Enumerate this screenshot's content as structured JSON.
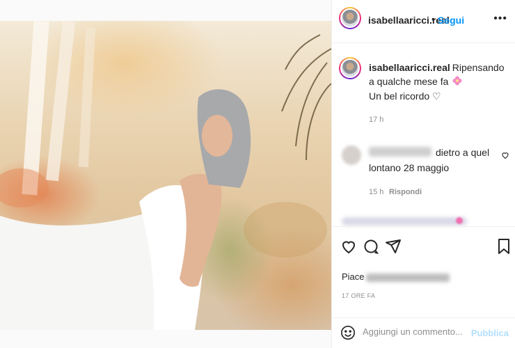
{
  "post": {
    "username": "isabellaaricci.real",
    "follow_label": "Segui",
    "more_label": "•••",
    "caption": "Ripensando a qualche mese fa",
    "caption_line2": "Un bel ricordo ♡",
    "caption_time": "17 h"
  },
  "comment": {
    "text": "dietro a quel lontano 28 maggio",
    "time": "15 h",
    "reply_label": "Rispondi"
  },
  "likes": {
    "prefix": "Piace"
  },
  "posted_ago": "17 ORE FA",
  "add_comment": {
    "placeholder": "Aggiungi un commento...",
    "publish_label": "Pubblica"
  },
  "colors": {
    "accent": "#0095f6",
    "publish_disabled": "#b2dffc",
    "muted": "#8e8e8e"
  }
}
